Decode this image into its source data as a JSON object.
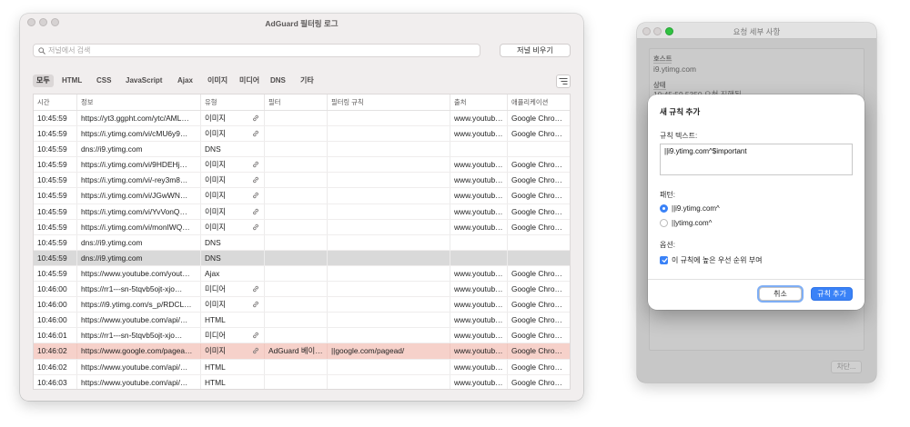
{
  "colors": {
    "accent": "#3a82f7",
    "blocked_row": "#f6d1ca",
    "selected_row": "#d9d9d9",
    "zoom_light": "#2fc240"
  },
  "log_window": {
    "title": "AdGuard 필터링 로그",
    "search": {
      "placeholder": "저널에서 검색",
      "value": "",
      "icon": "search-icon"
    },
    "clear_button": "저널 비우기",
    "filter_tabs": [
      {
        "label": "모두",
        "selected": true
      },
      {
        "label": "HTML",
        "selected": false
      },
      {
        "label": "CSS",
        "selected": false
      },
      {
        "label": "JavaScript",
        "selected": false
      },
      {
        "label": "Ajax",
        "selected": false
      },
      {
        "label": "이미지",
        "selected": false
      },
      {
        "label": "미디어",
        "selected": false
      },
      {
        "label": "DNS",
        "selected": false
      },
      {
        "label": "기타",
        "selected": false
      }
    ],
    "filter_menu_icon": "filter-list-icon",
    "columns": [
      "시간",
      "정보",
      "유형",
      "필터",
      "필터링 규칙",
      "출처",
      "애플리케이션"
    ],
    "rows": [
      {
        "time": "10:45:59",
        "info": "https://yt3.ggpht.com/ytc/AML…",
        "type": "이미지",
        "icon": "link-icon",
        "filter": "",
        "rule": "",
        "source": "www.youtub…",
        "app": "Google Chro…",
        "state": "normal"
      },
      {
        "time": "10:45:59",
        "info": "https://i.ytimg.com/vi/cMU6y9…",
        "type": "이미지",
        "icon": "link-icon",
        "filter": "",
        "rule": "",
        "source": "www.youtub…",
        "app": "Google Chro…",
        "state": "normal"
      },
      {
        "time": "10:45:59",
        "info": "dns://i9.ytimg.com",
        "type": "DNS",
        "icon": "",
        "filter": "",
        "rule": "",
        "source": "",
        "app": "",
        "state": "normal"
      },
      {
        "time": "10:45:59",
        "info": "https://i.ytimg.com/vi/9HDEHj…",
        "type": "이미지",
        "icon": "link-icon",
        "filter": "",
        "rule": "",
        "source": "www.youtub…",
        "app": "Google Chro…",
        "state": "normal"
      },
      {
        "time": "10:45:59",
        "info": "https://i.ytimg.com/vi/-rey3m8…",
        "type": "이미지",
        "icon": "link-icon",
        "filter": "",
        "rule": "",
        "source": "www.youtub…",
        "app": "Google Chro…",
        "state": "normal"
      },
      {
        "time": "10:45:59",
        "info": "https://i.ytimg.com/vi/JGwWN…",
        "type": "이미지",
        "icon": "link-icon",
        "filter": "",
        "rule": "",
        "source": "www.youtub…",
        "app": "Google Chro…",
        "state": "normal"
      },
      {
        "time": "10:45:59",
        "info": "https://i.ytimg.com/vi/YvVonQ…",
        "type": "이미지",
        "icon": "link-icon",
        "filter": "",
        "rule": "",
        "source": "www.youtub…",
        "app": "Google Chro…",
        "state": "normal"
      },
      {
        "time": "10:45:59",
        "info": "https://i.ytimg.com/vi/monIWQ…",
        "type": "이미지",
        "icon": "link-icon",
        "filter": "",
        "rule": "",
        "source": "www.youtub…",
        "app": "Google Chro…",
        "state": "normal"
      },
      {
        "time": "10:45:59",
        "info": "dns://i9.ytimg.com",
        "type": "DNS",
        "icon": "",
        "filter": "",
        "rule": "",
        "source": "",
        "app": "",
        "state": "normal"
      },
      {
        "time": "10:45:59",
        "info": "dns://i9.ytimg.com",
        "type": "DNS",
        "icon": "",
        "filter": "",
        "rule": "",
        "source": "",
        "app": "",
        "state": "selected"
      },
      {
        "time": "10:45:59",
        "info": "https://www.youtube.com/yout…",
        "type": "Ajax",
        "icon": "",
        "filter": "",
        "rule": "",
        "source": "www.youtub…",
        "app": "Google Chro…",
        "state": "normal"
      },
      {
        "time": "10:46:00",
        "info": "https://rr1---sn-5tqvb5ojt-xjo…",
        "type": "미디어",
        "icon": "link-icon",
        "filter": "",
        "rule": "",
        "source": "www.youtub…",
        "app": "Google Chro…",
        "state": "normal"
      },
      {
        "time": "10:46:00",
        "info": "https://i9.ytimg.com/s_p/RDCL…",
        "type": "이미지",
        "icon": "link-icon",
        "filter": "",
        "rule": "",
        "source": "www.youtub…",
        "app": "Google Chro…",
        "state": "normal"
      },
      {
        "time": "10:46:00",
        "info": "https://www.youtube.com/api/…",
        "type": "HTML",
        "icon": "",
        "filter": "",
        "rule": "",
        "source": "www.youtub…",
        "app": "Google Chro…",
        "state": "normal"
      },
      {
        "time": "10:46:01",
        "info": "https://rr1---sn-5tqvb5ojt-xjo…",
        "type": "미디어",
        "icon": "link-icon",
        "filter": "",
        "rule": "",
        "source": "www.youtub…",
        "app": "Google Chro…",
        "state": "normal"
      },
      {
        "time": "10:46:02",
        "info": "https://www.google.com/pagea…",
        "type": "이미지",
        "icon": "link-icon",
        "filter": "AdGuard 베이…",
        "rule": "||google.com/pagead/",
        "source": "www.youtub…",
        "app": "Google Chro…",
        "state": "blocked"
      },
      {
        "time": "10:46:02",
        "info": "https://www.youtube.com/api/…",
        "type": "HTML",
        "icon": "",
        "filter": "",
        "rule": "",
        "source": "www.youtub…",
        "app": "Google Chro…",
        "state": "normal"
      },
      {
        "time": "10:46:03",
        "info": "https://www.youtube.com/api/…",
        "type": "HTML",
        "icon": "",
        "filter": "",
        "rule": "",
        "source": "www.youtub…",
        "app": "Google Chro…",
        "state": "normal"
      }
    ]
  },
  "details_window": {
    "title": "요청 세부 사항",
    "host_label": "호스트",
    "host_value": "i9.ytimg.com",
    "status_label": "상태",
    "status_value": "10:45:59.5350 요청 진행됨",
    "block_button": "차단..."
  },
  "rule_sheet": {
    "title": "새 규칙 추가",
    "rule_text_label": "규칙 텍스트:",
    "rule_text_value": "||i9.ytimg.com^$important",
    "pattern_label": "패턴:",
    "patterns": [
      {
        "label": "||i9.ytimg.com^",
        "selected": true
      },
      {
        "label": "||ytimg.com^",
        "selected": false
      }
    ],
    "options_label": "옵션:",
    "options": [
      {
        "label": "이 규칙에 높은 우선 순위 부여",
        "checked": true
      }
    ],
    "cancel_button": "취소",
    "add_button": "규칙 추가"
  }
}
